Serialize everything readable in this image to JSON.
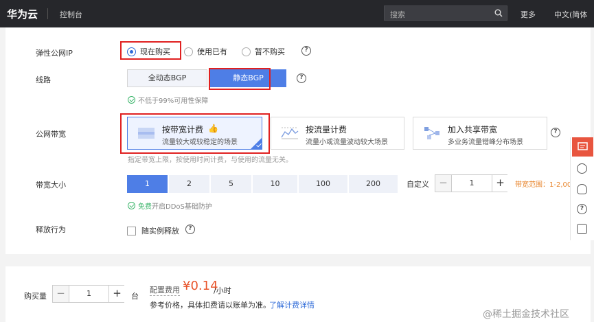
{
  "topbar": {
    "brand": "华为云",
    "console": "控制台",
    "search_placeholder": "搜索",
    "more": "更多",
    "lang": "中文(简体"
  },
  "eip": {
    "label": "弹性公网IP",
    "options": [
      "现在购买",
      "使用已有",
      "暂不购买"
    ],
    "selected": "现在购买"
  },
  "line": {
    "label": "线路",
    "options": [
      "全动态BGP",
      "静态BGP"
    ],
    "selected": "静态BGP",
    "hint": "不低于99%可用性保障"
  },
  "billing": {
    "label": "公网带宽",
    "cards": [
      {
        "title": "按带宽计费",
        "desc": "流量较大或较稳定的场景",
        "icon": "bandwidth-icon"
      },
      {
        "title": "按流量计费",
        "desc": "流量小或流量波动较大场景",
        "icon": "traffic-chart-icon"
      },
      {
        "title": "加入共享带宽",
        "desc": "多业务流量错峰分布场景",
        "icon": "shared-network-icon"
      }
    ],
    "selected": "按带宽计费",
    "hint": "指定带宽上限，按使用时间计费，与使用的流量无关。"
  },
  "bandwidth": {
    "label": "带宽大小",
    "options": [
      "1",
      "2",
      "5",
      "10",
      "100",
      "200"
    ],
    "selected": "1",
    "custom_label": "自定义",
    "custom_value": "1",
    "range_text": "带宽范围：1-2,00",
    "ddos_free": "免费",
    "ddos_text": "开启DDoS基础防护"
  },
  "release": {
    "label": "释放行为",
    "checkbox_label": "随实例释放"
  },
  "purchase": {
    "label": "购买量",
    "quantity": "1",
    "unit": "台",
    "fee_label": "配置费用",
    "price": "¥0.14",
    "price_unit": "/小时",
    "note": "参考价格，具体扣费请以账单为准。",
    "detail_link": "了解计费详情"
  },
  "colors": {
    "accent": "#4e7ee6",
    "price": "#e8552c",
    "highlight_box": "#e02020",
    "topbar": "#26272b"
  },
  "watermark": "@稀土掘金技术社区"
}
